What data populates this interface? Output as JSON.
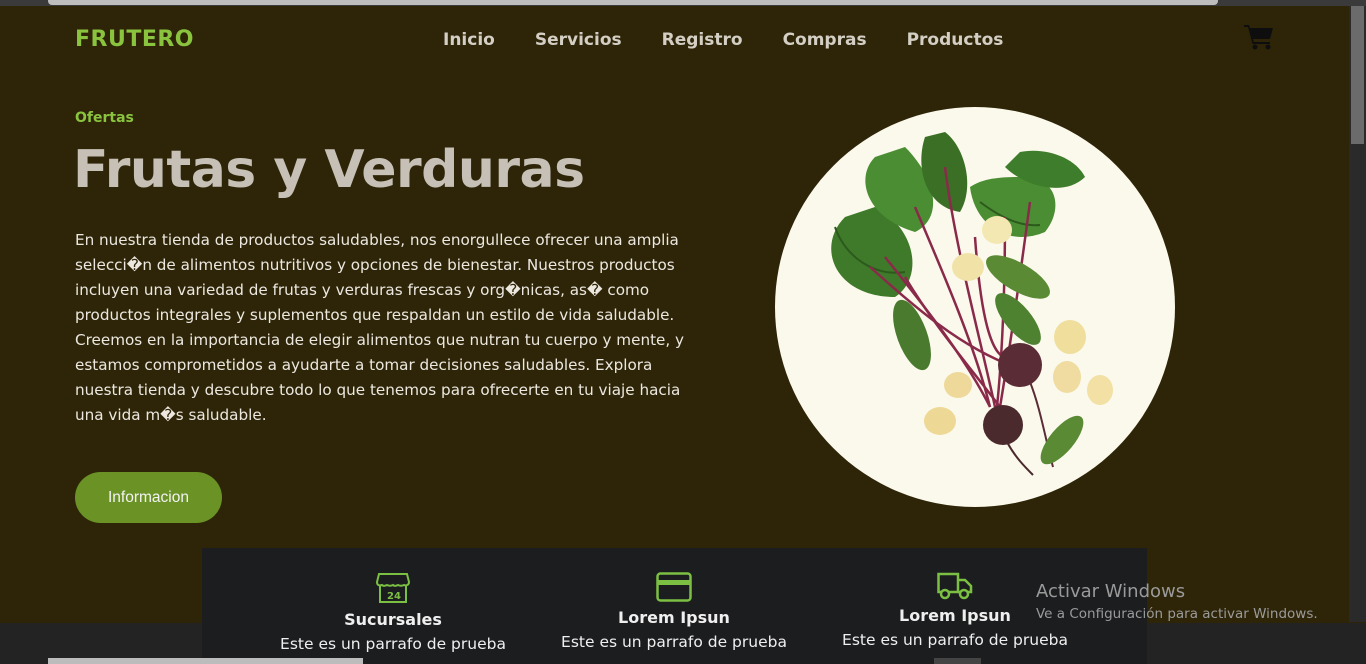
{
  "brand": {
    "logo": "FRUTERO",
    "accent": "#8ac43f"
  },
  "nav": {
    "items": [
      "Inicio",
      "Servicios",
      "Registro",
      "Compras",
      "Productos"
    ],
    "cart_icon": "shopping-cart-icon"
  },
  "hero": {
    "eyebrow": "Ofertas",
    "title": "Frutas y Verduras",
    "text": "En nuestra tienda de productos saludables, nos enorgullece ofrecer una amplia selecci�n de alimentos nutritivos y opciones de bienestar. Nuestros productos incluyen una variedad de frutas y verduras frescas y org�nicas, as� como productos integrales y suplementos que respaldan un estilo de vida saludable. Creemos en la importancia de elegir alimentos que nutran tu cuerpo y mente, y estamos comprometidos a ayudarte a tomar decisiones saludables. Explora nuestra tienda y descubre todo lo que tenemos para ofrecerte en tu viaje hacia una vida m�s saludable.",
    "button": "Informacion",
    "image": "beets-cucumbers-potatoes"
  },
  "features": [
    {
      "icon": "store-24h-icon",
      "title": "Sucursales",
      "text": "Este es un parrafo de prueba"
    },
    {
      "icon": "credit-card-icon",
      "title": "Lorem Ipsun",
      "text": "Este es un parrafo de prueba"
    },
    {
      "icon": "delivery-truck-icon",
      "title": "Lorem Ipsun",
      "text": "Este es un parrafo de prueba"
    }
  ],
  "watermark": {
    "line1": "Activar Windows",
    "line2": "Ve a Configuración para activar Windows."
  },
  "colors": {
    "background": "#2e2508",
    "accent": "#8ac43f",
    "button": "#6a9225",
    "features_bg": "#1c1d1f",
    "circle_bg": "#fbf9ec"
  }
}
